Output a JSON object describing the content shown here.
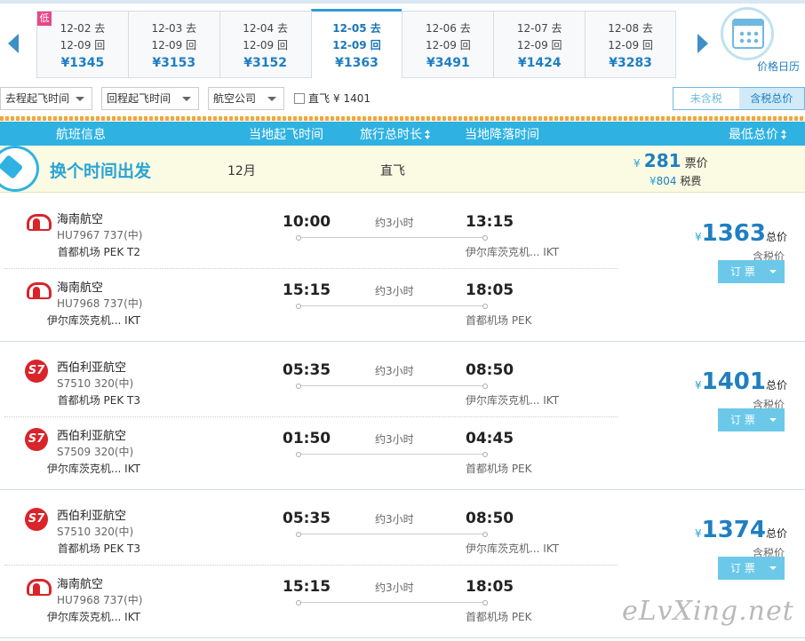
{
  "date_bar": {
    "cells": [
      {
        "out": "12-02 去",
        "ret": "12-09 回",
        "price": "¥1345",
        "badge": "低"
      },
      {
        "out": "12-03 去",
        "ret": "12-09 回",
        "price": "¥3153"
      },
      {
        "out": "12-04 去",
        "ret": "12-09 回",
        "price": "¥3152"
      },
      {
        "out": "12-05 去",
        "ret": "12-09 回",
        "price": "¥1363",
        "selected": true
      },
      {
        "out": "12-06 去",
        "ret": "12-09 回",
        "price": "¥3491"
      },
      {
        "out": "12-07 去",
        "ret": "12-09 回",
        "price": "¥1424"
      },
      {
        "out": "12-08 去",
        "ret": "12-09 回",
        "price": "¥3283"
      }
    ],
    "calendar_label": "价格日历"
  },
  "filters": {
    "outbound_time": "去程起飞时间",
    "return_time": "回程起飞时间",
    "airline": "航空公司",
    "direct_label": "直飞",
    "direct_price": "¥ 1401",
    "tax_excluded": "未含税",
    "tax_included": "含税总价"
  },
  "header": {
    "flight_info": "航班信息",
    "dep_time": "当地起飞时间",
    "duration": "旅行总时长",
    "arr_time": "当地降落时间",
    "lowest_price": "最低总价"
  },
  "promo": {
    "title": "换个时间出发",
    "month": "12月",
    "direct": "直飞",
    "ticket_yen": "¥",
    "ticket_price": "281",
    "ticket_label": "票价",
    "tax_yen": "¥",
    "tax_price": "804",
    "tax_label": "税费"
  },
  "groups": [
    {
      "price": "1363",
      "total_label": "总价",
      "incl": "含税价",
      "book": "订 票",
      "legs": [
        {
          "logo": "hainan-airlines",
          "airline": "海南航空",
          "flight": "HU7967 737(中)",
          "dep": "10:00",
          "arr": "13:15",
          "duration": "约3小时",
          "dep_ap": "首都机场 PEK T2",
          "arr_ap": "伊尔库茨克机... IKT"
        },
        {
          "logo": "hainan-airlines",
          "airline": "海南航空",
          "flight": "HU7968 737(中)",
          "dep": "15:15",
          "arr": "18:05",
          "duration": "约3小时",
          "dep_ap": "伊尔库茨克机... IKT",
          "arr_ap": "首都机场 PEK"
        }
      ]
    },
    {
      "price": "1401",
      "total_label": "总价",
      "incl": "含税价",
      "book": "订 票",
      "legs": [
        {
          "logo": "s7-airlines",
          "logo_text": "S7",
          "airline": "西伯利亚航空",
          "flight": "S7510 320(中)",
          "dep": "05:35",
          "arr": "08:50",
          "duration": "约3小时",
          "dep_ap": "首都机场 PEK T3",
          "arr_ap": "伊尔库茨克机... IKT"
        },
        {
          "logo": "s7-airlines",
          "logo_text": "S7",
          "airline": "西伯利亚航空",
          "flight": "S7509 320(中)",
          "dep": "01:50",
          "arr": "04:45",
          "duration": "约3小时",
          "dep_ap": "伊尔库茨克机... IKT",
          "arr_ap": "首都机场 PEK"
        }
      ]
    },
    {
      "price": "1374",
      "total_label": "总价",
      "incl": "含税价",
      "book": "订 票",
      "legs": [
        {
          "logo": "s7-airlines",
          "logo_text": "S7",
          "airline": "西伯利亚航空",
          "flight": "S7510 320(中)",
          "dep": "05:35",
          "arr": "08:50",
          "duration": "约3小时",
          "dep_ap": "首都机场 PEK T3",
          "arr_ap": "伊尔库茨克机... IKT"
        },
        {
          "logo": "hainan-airlines",
          "airline": "海南航空",
          "flight": "HU7968 737(中)",
          "dep": "15:15",
          "arr": "18:05",
          "duration": "约3小时",
          "dep_ap": "伊尔库茨克机... IKT",
          "arr_ap": "首都机场 PEK"
        }
      ]
    }
  ],
  "watermark": "eLvXing.net",
  "colors": {
    "accent": "#2fb2e2",
    "price": "#1f7fc1",
    "button": "#6cc8e8",
    "low_badge": "#e8478a"
  }
}
